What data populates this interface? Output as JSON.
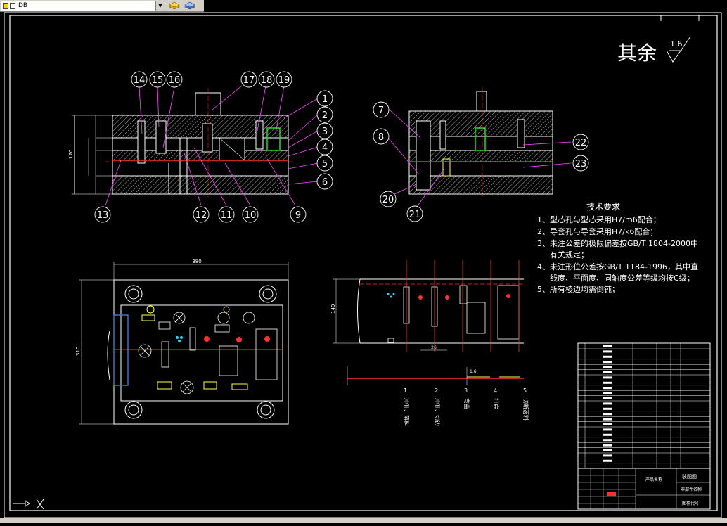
{
  "toolbar": {
    "layer_name": "DB",
    "layer_dropdown_glyph": "▼",
    "buttons": [
      {
        "name": "layer-stack-icon",
        "color": "#e8b000"
      },
      {
        "name": "layer-properties-icon",
        "color": "#3a6fd8"
      }
    ]
  },
  "drawing": {
    "surface_finish_text": "其余",
    "surface_finish_value": "1.6",
    "tech_title": "技术要求",
    "tech_items": [
      "1、型芯孔与型芯采用H7/m6配合；",
      "2、导套孔与导套采用H7/k6配合；",
      "3、未注公差的极限偏差按GB/T 1804-2000中",
      "有关规定；",
      "4、未注形位公差按GB/T 1184-1996，其中直",
      "线度、平面度、同轴度公差等级均按C级；",
      "5、所有棱边均需倒钝；"
    ],
    "part_numbers": [
      "14",
      "15",
      "16",
      "17",
      "18",
      "19",
      "1",
      "2",
      "3",
      "4",
      "5",
      "6",
      "13",
      "12",
      "11",
      "10",
      "9",
      "7",
      "8",
      "22",
      "23",
      "20",
      "21"
    ],
    "dimensions": {
      "section_height": "170",
      "plan_width": "380",
      "plan_height": "310",
      "strip_height": "140",
      "strip_pitch": "26",
      "strip_thickness": "1.6"
    },
    "station_labels": [
      {
        "num": "1",
        "text": "冲孔、落料"
      },
      {
        "num": "2",
        "text": "冲孔、切边"
      },
      {
        "num": "3",
        "text": "弯曲"
      },
      {
        "num": "4",
        "text": "打扁"
      },
      {
        "num": "5",
        "text": "切断落料"
      }
    ],
    "title_block": {
      "drawing_name": "装配图",
      "product_label": "产品名称",
      "material_label": "零部件名称",
      "code_label": "图样代号"
    }
  },
  "colors": {
    "line": "#ffffff",
    "hatch": "#ffffff",
    "center": "#ff3030",
    "leader": "#ff4bff",
    "accent_green": "#20e020",
    "accent_cyan": "#30d0ff",
    "accent_yellow": "#ffff40"
  }
}
